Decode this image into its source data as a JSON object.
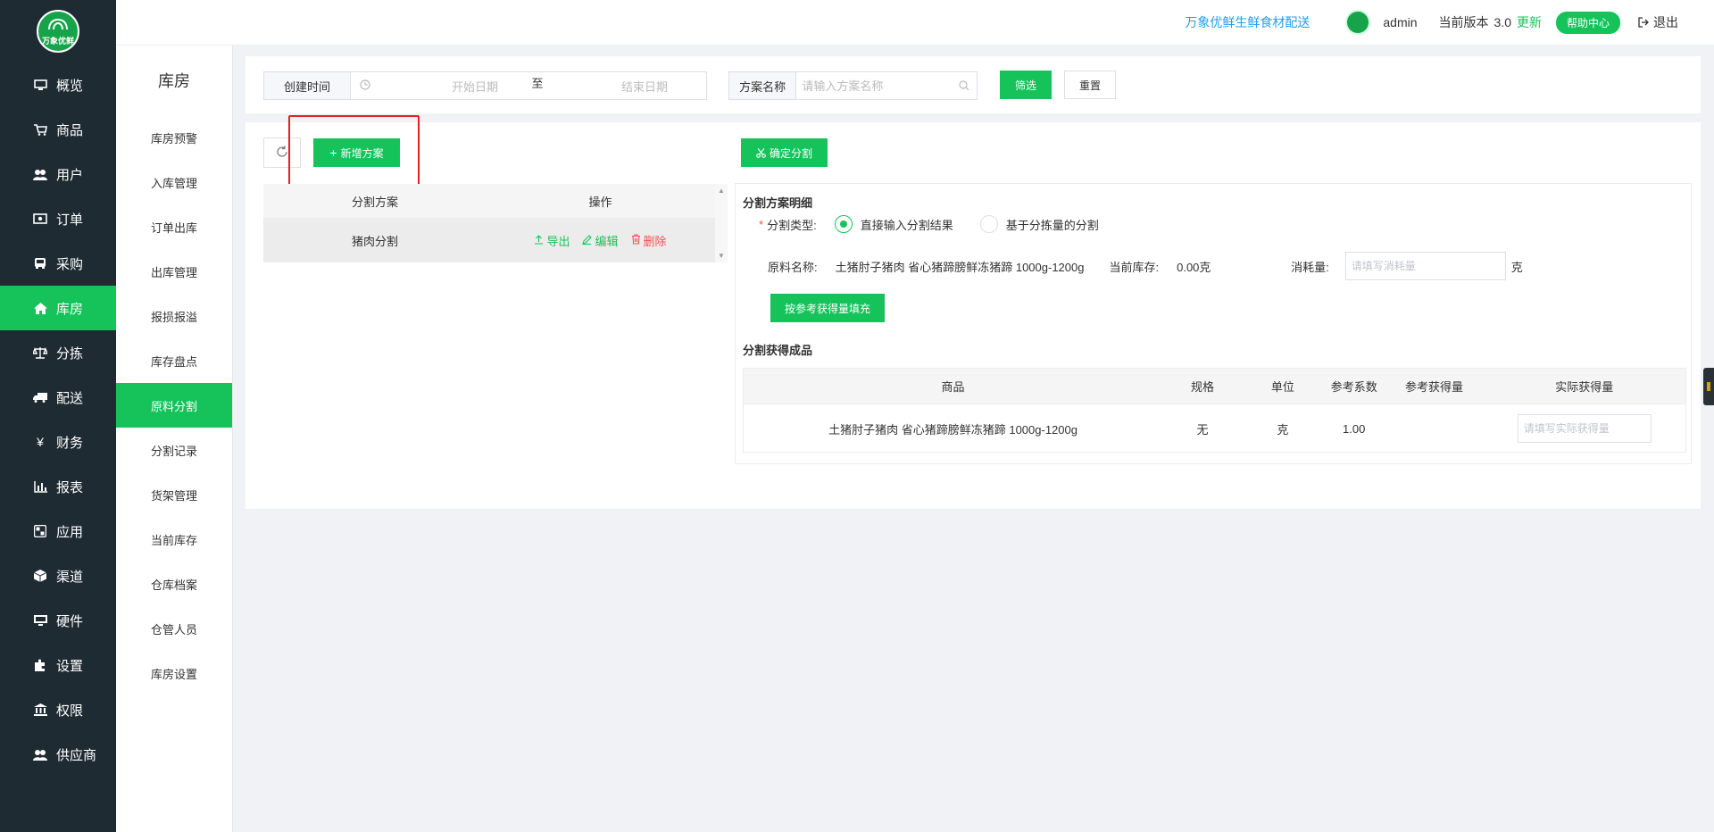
{
  "brand": {
    "logo_text": "万象优鲜"
  },
  "nav": {
    "items": [
      {
        "label": "概览",
        "icon": "monitor-icon"
      },
      {
        "label": "商品",
        "icon": "cart-icon"
      },
      {
        "label": "用户",
        "icon": "users-icon"
      },
      {
        "label": "订单",
        "icon": "money-icon"
      },
      {
        "label": "采购",
        "icon": "bus-icon"
      },
      {
        "label": "库房",
        "icon": "home-icon"
      },
      {
        "label": "分拣",
        "icon": "scale-icon"
      },
      {
        "label": "配送",
        "icon": "truck-icon"
      },
      {
        "label": "财务",
        "icon": "yen-icon"
      },
      {
        "label": "报表",
        "icon": "bar-chart-icon"
      },
      {
        "label": "应用",
        "icon": "apps-icon"
      },
      {
        "label": "渠道",
        "icon": "cube-icon"
      },
      {
        "label": "硬件",
        "icon": "desktop-icon"
      },
      {
        "label": "设置",
        "icon": "puzzle-icon"
      },
      {
        "label": "权限",
        "icon": "bank-icon"
      },
      {
        "label": "供应商",
        "icon": "supplier-users-icon"
      }
    ],
    "active_index": 5
  },
  "header": {
    "company": "万象优鲜生鲜食材配送",
    "user": "admin",
    "version_label": "当前版本",
    "version": "3.0",
    "update": "更新",
    "help": "帮助中心",
    "logout": "退出"
  },
  "subnav": {
    "title": "库房",
    "items": [
      "库房预警",
      "入库管理",
      "订单出库",
      "出库管理",
      "报损报溢",
      "库存盘点",
      "原料分割",
      "分割记录",
      "货架管理",
      "当前库存",
      "仓库档案",
      "仓管人员",
      "库房设置"
    ],
    "active_index": 6
  },
  "filter": {
    "created_label": "创建时间",
    "start_placeholder": "开始日期",
    "to": "至",
    "end_placeholder": "结束日期",
    "name_label": "方案名称",
    "name_placeholder": "请输入方案名称",
    "screen": "筛选",
    "reset": "重置"
  },
  "toolbar": {
    "add": "新增方案",
    "confirm": "确定分割"
  },
  "plan_table": {
    "headers": [
      "分割方案",
      "操作"
    ],
    "rows": [
      {
        "name": "猪肉分割",
        "export": "导出",
        "edit": "编辑",
        "delete": "删除"
      }
    ]
  },
  "detail": {
    "title": "分割方案明细",
    "type_label": "分割类型:",
    "type_options": [
      "直接输入分割结果",
      "基于分拣量的分割"
    ],
    "type_selected": 0,
    "material_label": "原料名称:",
    "material_value": "土猪肘子猪肉 省心猪蹄膀鲜冻猪蹄 1000g-1200g",
    "stock_label": "当前库存:",
    "stock_value": "0.00克",
    "consume_label": "消耗量:",
    "consume_placeholder": "请填写消耗量",
    "consume_unit": "克",
    "fill_button": "按参考获得量填充",
    "result_title": "分割获得成品",
    "result_headers": [
      "商品",
      "规格",
      "单位",
      "参考系数",
      "参考获得量",
      "实际获得量"
    ],
    "result_rows": [
      {
        "product": "土猪肘子猪肉 省心猪蹄膀鲜冻猪蹄 1000g-1200g",
        "spec": "无",
        "unit": "克",
        "coef": "1.00",
        "ref_amount": "",
        "actual_placeholder": "请填写实际获得量"
      }
    ]
  },
  "colors": {
    "accent": "#16c35a",
    "nav_bg": "#1f2b33",
    "highlight": "#e62020",
    "danger": "#ef5350",
    "link": "#1e9ff2"
  }
}
